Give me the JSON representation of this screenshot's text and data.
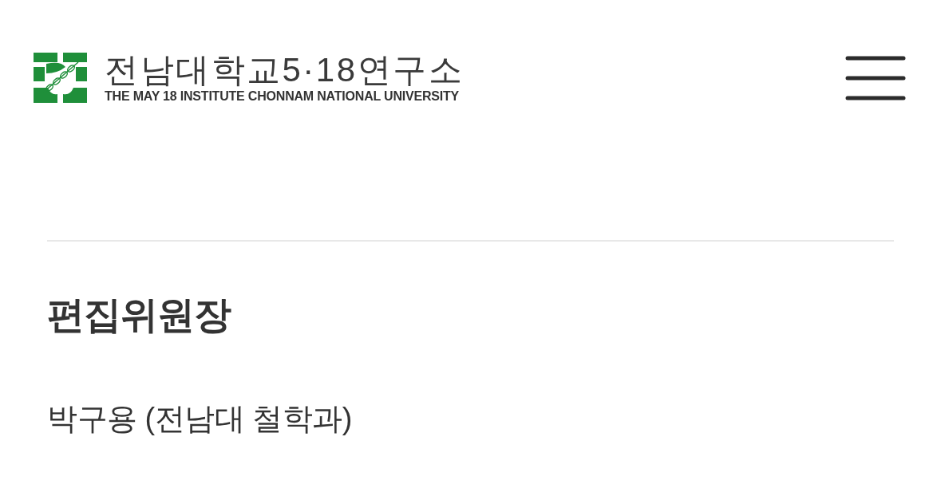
{
  "header": {
    "logo": {
      "title": "전남대학교5·18연구소",
      "subtitle": "THE MAY 18 INSTITUTE CHONNAM NATIONAL UNIVERSITY"
    }
  },
  "section": {
    "heading": "편집위원장",
    "members": [
      "박구용 (전남대 철학과)"
    ]
  }
}
